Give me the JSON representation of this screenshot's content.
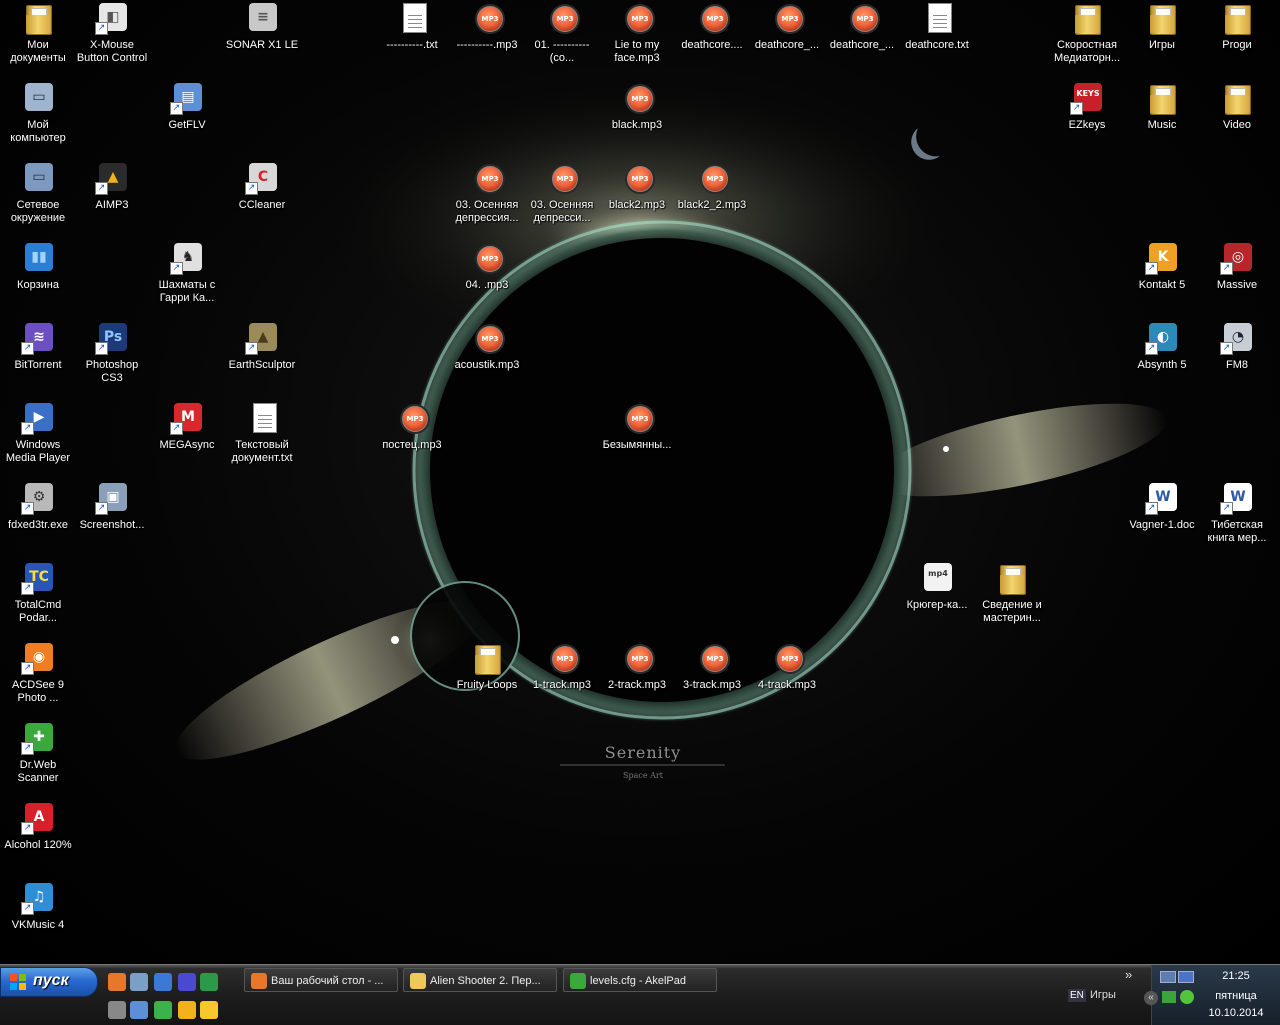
{
  "desktop_icons": [
    {
      "label": "Мои документы",
      "icon": "folder-documents-icon",
      "kind": "folder"
    },
    {
      "label": "X-Mouse Button Control",
      "icon": "mouse-icon",
      "kind": "app"
    },
    {
      "label": "SONAR X1 LE",
      "icon": "sonar-icon",
      "kind": "app"
    },
    {
      "label": "----------.txt",
      "icon": "text-file-icon",
      "kind": "doc"
    },
    {
      "label": "----------.mp3",
      "icon": "mp3-file-icon",
      "kind": "mp3"
    },
    {
      "label": "01. ----------(co...",
      "icon": "mp3-file-icon",
      "kind": "mp3"
    },
    {
      "label": "Lie to my face.mp3",
      "icon": "mp3-file-icon",
      "kind": "mp3"
    },
    {
      "label": "deathcore....",
      "icon": "mp3-file-icon",
      "kind": "mp3"
    },
    {
      "label": "deathcore_...",
      "icon": "mp3-file-icon",
      "kind": "mp3"
    },
    {
      "label": "deathcore_...",
      "icon": "mp3-file-icon",
      "kind": "mp3"
    },
    {
      "label": "deathcore.txt",
      "icon": "text-file-icon",
      "kind": "doc"
    },
    {
      "label": "Скоростная Медиаторн...",
      "icon": "folder-icon",
      "kind": "folder"
    },
    {
      "label": "Игры",
      "icon": "folder-icon",
      "kind": "folder"
    },
    {
      "label": "Progи",
      "icon": "folder-icon",
      "kind": "folder"
    },
    {
      "label": "Мой компьютер",
      "icon": "my-computer-icon",
      "kind": "app"
    },
    {
      "label": "GetFLV",
      "icon": "getflv-icon",
      "kind": "app"
    },
    {
      "label": "black.mp3",
      "icon": "mp3-file-icon",
      "kind": "mp3"
    },
    {
      "label": "EZkeys",
      "icon": "ezkeys-icon",
      "kind": "app"
    },
    {
      "label": "Music",
      "icon": "folder-icon",
      "kind": "folder"
    },
    {
      "label": "Video",
      "icon": "folder-icon",
      "kind": "folder"
    },
    {
      "label": "Сетевое окружение",
      "icon": "network-icon",
      "kind": "app"
    },
    {
      "label": "AIMP3",
      "icon": "aimp-icon",
      "kind": "app"
    },
    {
      "label": "CCleaner",
      "icon": "ccleaner-icon",
      "kind": "app"
    },
    {
      "label": "03. Осенняя депрессия...",
      "icon": "mp3-file-icon",
      "kind": "mp3"
    },
    {
      "label": "03. Осенняя депресси...",
      "icon": "mp3-file-icon",
      "kind": "mp3"
    },
    {
      "label": "black2.mp3",
      "icon": "mp3-file-icon",
      "kind": "mp3"
    },
    {
      "label": "black2_2.mp3",
      "icon": "mp3-file-icon",
      "kind": "mp3"
    },
    {
      "label": "Корзина",
      "icon": "recycle-bin-icon",
      "kind": "app"
    },
    {
      "label": "Шахматы с Гарри Ка...",
      "icon": "chess-icon",
      "kind": "app"
    },
    {
      "label": "04. .mp3",
      "icon": "mp3-file-icon",
      "kind": "mp3"
    },
    {
      "label": "Kontakt 5",
      "icon": "kontakt-icon",
      "kind": "app"
    },
    {
      "label": "Massive",
      "icon": "massive-icon",
      "kind": "app"
    },
    {
      "label": "BitTorrent",
      "icon": "bittorrent-icon",
      "kind": "app"
    },
    {
      "label": "Photoshop CS3",
      "icon": "photoshop-icon",
      "kind": "app"
    },
    {
      "label": "EarthSculptor",
      "icon": "earthsculptor-icon",
      "kind": "app"
    },
    {
      "label": "acoustik.mp3",
      "icon": "mp3-file-icon",
      "kind": "mp3"
    },
    {
      "label": "Absynth 5",
      "icon": "absynth-icon",
      "kind": "app"
    },
    {
      "label": "FM8",
      "icon": "fm8-icon",
      "kind": "app"
    },
    {
      "label": "Windows Media Player",
      "icon": "media-player-icon",
      "kind": "app"
    },
    {
      "label": "MEGAsync",
      "icon": "megasync-icon",
      "kind": "app"
    },
    {
      "label": "Текстовый документ.txt",
      "icon": "text-file-icon",
      "kind": "doc"
    },
    {
      "label": "постец.mp3",
      "icon": "mp3-file-icon",
      "kind": "mp3"
    },
    {
      "label": "Безымянны...",
      "icon": "mp3-file-icon",
      "kind": "mp3"
    },
    {
      "label": "fdxed3tr.exe",
      "icon": "installer-icon",
      "kind": "app"
    },
    {
      "label": "Screenshot...",
      "icon": "screenshot-icon",
      "kind": "app"
    },
    {
      "label": "Vagner-1.doc",
      "icon": "word-doc-icon",
      "kind": "app"
    },
    {
      "label": "Тибетская книга мер...",
      "icon": "word-doc-icon",
      "kind": "app"
    },
    {
      "label": "TotalCmd Podar...",
      "icon": "totalcmd-icon",
      "kind": "app"
    },
    {
      "label": "Крюгер-ка...",
      "icon": "mp4-file-icon",
      "kind": "app"
    },
    {
      "label": "Сведение и мастерин...",
      "icon": "folder-icon",
      "kind": "folder"
    },
    {
      "label": "ACDSee 9 Photo ...",
      "icon": "acdsee-icon",
      "kind": "app"
    },
    {
      "label": "Fruity Loops",
      "icon": "folder-icon",
      "kind": "folder"
    },
    {
      "label": "1-track.mp3",
      "icon": "mp3-file-icon",
      "kind": "mp3"
    },
    {
      "label": "2-track.mp3",
      "icon": "mp3-file-icon",
      "kind": "mp3"
    },
    {
      "label": "3-track.mp3",
      "icon": "mp3-file-icon",
      "kind": "mp3"
    },
    {
      "label": "4-track.mp3",
      "icon": "mp3-file-icon",
      "kind": "mp3"
    },
    {
      "label": "Dr.Web Scanner",
      "icon": "drweb-icon",
      "kind": "app"
    },
    {
      "label": "Alcohol 120%",
      "icon": "alcohol-icon",
      "kind": "app"
    },
    {
      "label": "VKMusic 4",
      "icon": "vkmusic-icon",
      "kind": "app"
    }
  ],
  "wallpaper": {
    "title": "Serenity",
    "subtitle": "Space Art"
  },
  "mp3_badge": "MP3",
  "taskbar": {
    "start_label": "пуск",
    "quick_launch": [
      "firefox-icon",
      "network-tool-icon",
      "show-desktop-icon",
      "app-launcher-icon",
      "totalcmd-small-icon",
      "window-icon",
      "switch-icon",
      "media-icon",
      "aimp-small-icon",
      "fl-studio-icon"
    ],
    "tasks": [
      {
        "label": "Ваш рабочий стол - ...",
        "icon": "firefox-icon"
      },
      {
        "label": "Alien Shooter 2. Пер...",
        "icon": "folder-icon"
      },
      {
        "label": "levels.cfg - AkelPad",
        "icon": "akelpad-icon"
      }
    ],
    "chevron": "»",
    "lang": "EN",
    "toolbar_label": "Игры",
    "clock": {
      "time": "21:25",
      "day": "пятница",
      "date": "10.10.2014"
    }
  },
  "colors": {
    "mp3_orange": "#f0643a",
    "start_blue": "#2a6ad1",
    "folder_yellow": "#eec85a"
  }
}
